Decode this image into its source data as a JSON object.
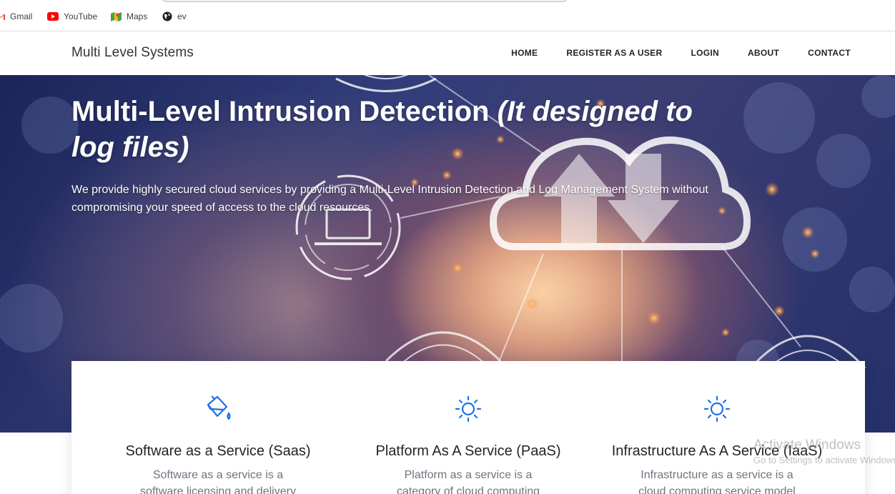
{
  "bookmarks": [
    {
      "label": "Gmail",
      "icon": "gmail-icon"
    },
    {
      "label": "YouTube",
      "icon": "youtube-icon"
    },
    {
      "label": "Maps",
      "icon": "maps-icon"
    },
    {
      "label": "ev",
      "icon": "globe-icon"
    }
  ],
  "navbar": {
    "brand": "Multi Level Systems",
    "links": [
      "HOME",
      "REGISTER AS A USER",
      "LOGIN",
      "ABOUT",
      "CONTACT"
    ]
  },
  "hero": {
    "title_main": "Multi-Level Intrusion Detection",
    "title_italic": "(It designed to log files)",
    "description": "We provide highly secured cloud services by providing a Multi-Level Intrusion Detection and Log Management System without compromising your speed of access to the cloud resources."
  },
  "services": [
    {
      "icon": "paint-bucket-icon",
      "title": "Software as a Service (Saas)",
      "description": "Software as a service is a software licensing and delivery model in which"
    },
    {
      "icon": "sun-icon",
      "title": "Platform As A Service (PaaS)",
      "description": "Platform as a service is a category of cloud computing services that allows customers"
    },
    {
      "icon": "sun-icon",
      "title": "Infrastructure As A Service (IaaS)",
      "description": "Infrastructure as a service is a cloud computing service model by means of"
    }
  ],
  "watermark": {
    "line1": "Activate Windows",
    "line2": "Go to Settings to activate Windows."
  },
  "colors": {
    "accent": "#1a73e8",
    "hero_dark": "#1c2559"
  }
}
